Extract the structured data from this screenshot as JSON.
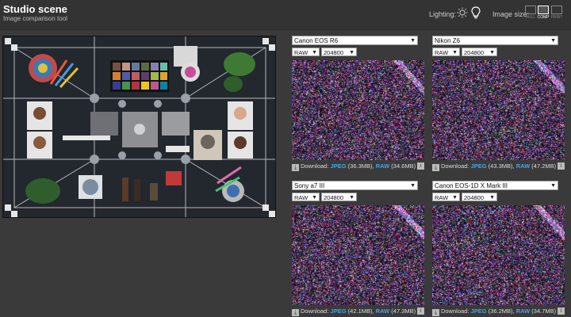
{
  "header": {
    "title": "Studio scene",
    "subtitle": "Image comparison tool",
    "lighting_label": "Lighting:",
    "image_size_label": "Image size:",
    "sizes": [
      {
        "label": "FULL",
        "active": false
      },
      {
        "label": "COMP",
        "active": true
      },
      {
        "label": "PRINT",
        "active": false
      }
    ]
  },
  "download_label": "Download:",
  "panels": [
    {
      "camera": "Canon EOS R6",
      "format": "RAW",
      "iso": "204800",
      "jpeg_label": "JPEG",
      "jpeg_size": "(36.3MB),",
      "raw_label": "RAW",
      "raw_size": "(34.6MB)"
    },
    {
      "camera": "Nikon Z6",
      "format": "RAW",
      "iso": "204800",
      "jpeg_label": "JPEG",
      "jpeg_size": "(43.3MB),",
      "raw_label": "RAW",
      "raw_size": "(47.2MB)"
    },
    {
      "camera": "Sony a7 III",
      "format": "RAW",
      "iso": "204800",
      "jpeg_label": "JPEG",
      "jpeg_size": "(42.1MB),",
      "raw_label": "RAW",
      "raw_size": "(47.3MB)"
    },
    {
      "camera": "Canon EOS-1D X Mark III",
      "format": "RAW",
      "iso": "204800",
      "jpeg_label": "JPEG",
      "jpeg_size": "(36.2MB),",
      "raw_label": "RAW",
      "raw_size": "(34.7MB)"
    }
  ],
  "colors": {
    "accent": "#4aa3e6",
    "background": "#3a3a3a"
  }
}
